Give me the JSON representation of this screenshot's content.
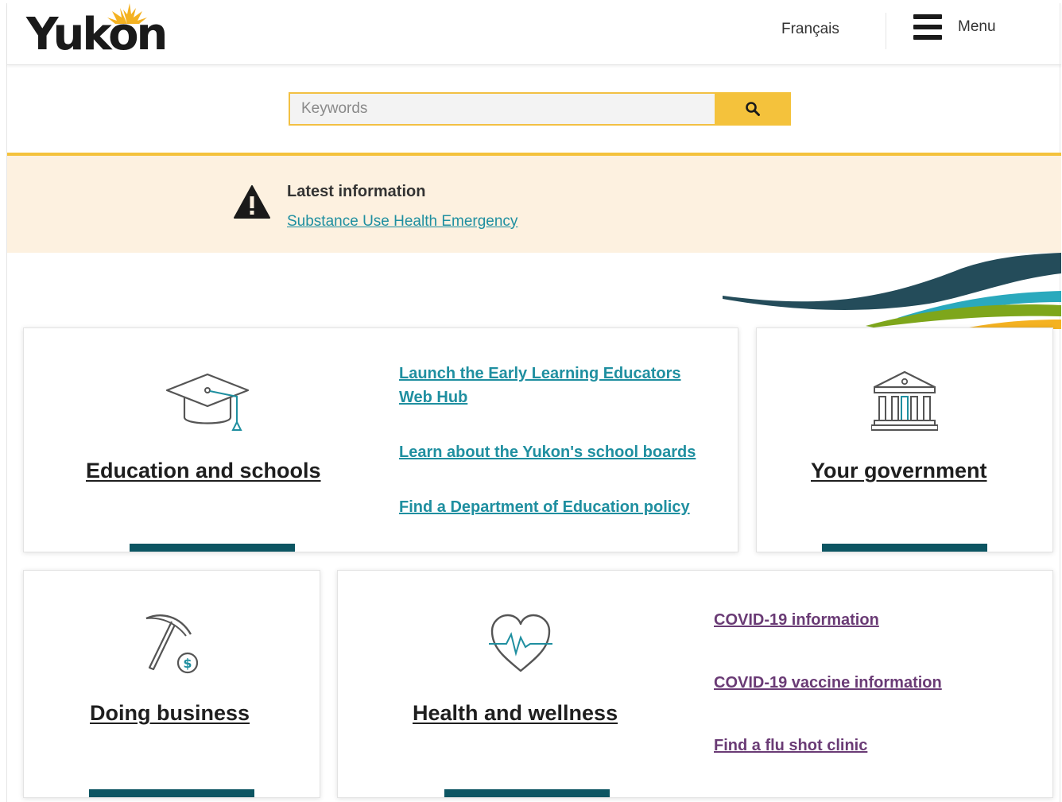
{
  "header": {
    "logo_text": "Yukon",
    "language_link": "Français",
    "menu_label": "Menu"
  },
  "search": {
    "placeholder": "Keywords"
  },
  "alert": {
    "title": "Latest information",
    "link": "Substance Use Health Emergency"
  },
  "cards": {
    "education": {
      "title": "Education and schools",
      "links": [
        "Launch the Early Learning Educators Web Hub",
        "Learn about the Yukon's school boards",
        "Find a Department of Education policy"
      ]
    },
    "government": {
      "title": "Your government"
    },
    "business": {
      "title": "Doing business"
    },
    "health": {
      "title": "Health and wellness",
      "links": [
        "COVID-19 information",
        "COVID-19 vaccine information",
        "Find a flu shot clinic"
      ]
    }
  },
  "colors": {
    "accent_yellow": "#f4c23c",
    "link_teal": "#1f8fa0",
    "link_purple": "#6a3b75",
    "bar_teal": "#0c5562",
    "alert_bg": "#fdf1e0"
  },
  "icons": {
    "search": "search-icon",
    "menu": "hamburger-menu-icon",
    "alert": "warning-icon",
    "education": "graduation-cap-icon",
    "government": "government-building-icon",
    "business": "pickaxe-dollar-icon",
    "health": "heart-pulse-icon"
  }
}
